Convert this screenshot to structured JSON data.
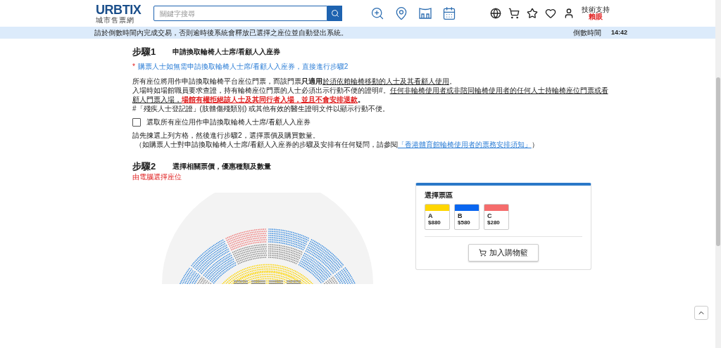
{
  "header": {
    "logo": "URBTIX",
    "logo_subtitle": "城市售票網",
    "search": {
      "placeholder": "關鍵字搜尋"
    },
    "support_label": "技術支持",
    "support_brand": "賴眼"
  },
  "notice_bar": {
    "message": "請於倒數時間內完成交易，否則逾時後系統會釋放已選擇之座位並自動登出系統。",
    "countdown_label": "倒數時間",
    "countdown": "14:42"
  },
  "step1": {
    "number": "步驟1",
    "title": "申請換取輪椅人士席/看顧人入座券",
    "note_mark": "*",
    "note": "購票人士如無需申請換取輪椅人士席/看顧人入座券，直接進行步驟2",
    "paragraph": [
      {
        "kind": "plain",
        "text": "所有座位將用作申請換取輪椅平台座位門票，而該門票"
      },
      {
        "kind": "bold",
        "text": "只適用"
      },
      {
        "kind": "underline",
        "text": "於須依賴輪椅移動的人士及其看顧人使用"
      },
      {
        "kind": "plain",
        "text": "。"
      },
      {
        "kind": "break"
      },
      {
        "kind": "plain",
        "text": "入場時如場館職員要求查證，持有輪椅座位門票的人士必須出示行動不便的證明#。"
      },
      {
        "kind": "underline",
        "text": "任何非輪椅使用者或非陪同輪椅使用者的任何人士持輪椅座位門票或看顧人門票入場，"
      },
      {
        "kind": "warning",
        "text": "場館有權拒絕該人士及其同行者入場，並且不會安排退款"
      },
      {
        "kind": "bold",
        "text": "。"
      }
    ],
    "footnote": "#「殘疾人士登記證」(肢體傷殘類別) 或其他有效的醫生證明文件以顯示行動不便。",
    "checkbox": {
      "label": "選取所有座位用作申請換取輪椅人士席/看顧人入座券",
      "checked": false
    },
    "instruction": "請先揀選上列方格，然後進行步驟2，選擇票價及購買數量。",
    "help_text": "（如購票人士對申請換取輪椅人士席/看顧人入座券的步驟及安排有任何疑問，請參閱",
    "help_link": "「香港體育館輪椅使用者的票務安排須知」",
    "help_close": "）"
  },
  "step2": {
    "number": "步驟2",
    "title": "選擇相關票價，優惠種類及數量",
    "auto_select_link": "由電腦選擇座位",
    "price_panel": {
      "title": "選擇票區",
      "zones": [
        {
          "code": "A",
          "price": "$880",
          "color": "#ffd600"
        },
        {
          "code": "B",
          "price": "$580",
          "color": "#0a66f0"
        },
        {
          "code": "C",
          "price": "$280",
          "color": "#f56c6c"
        }
      ],
      "add_to_cart": "加入購物籃"
    }
  }
}
